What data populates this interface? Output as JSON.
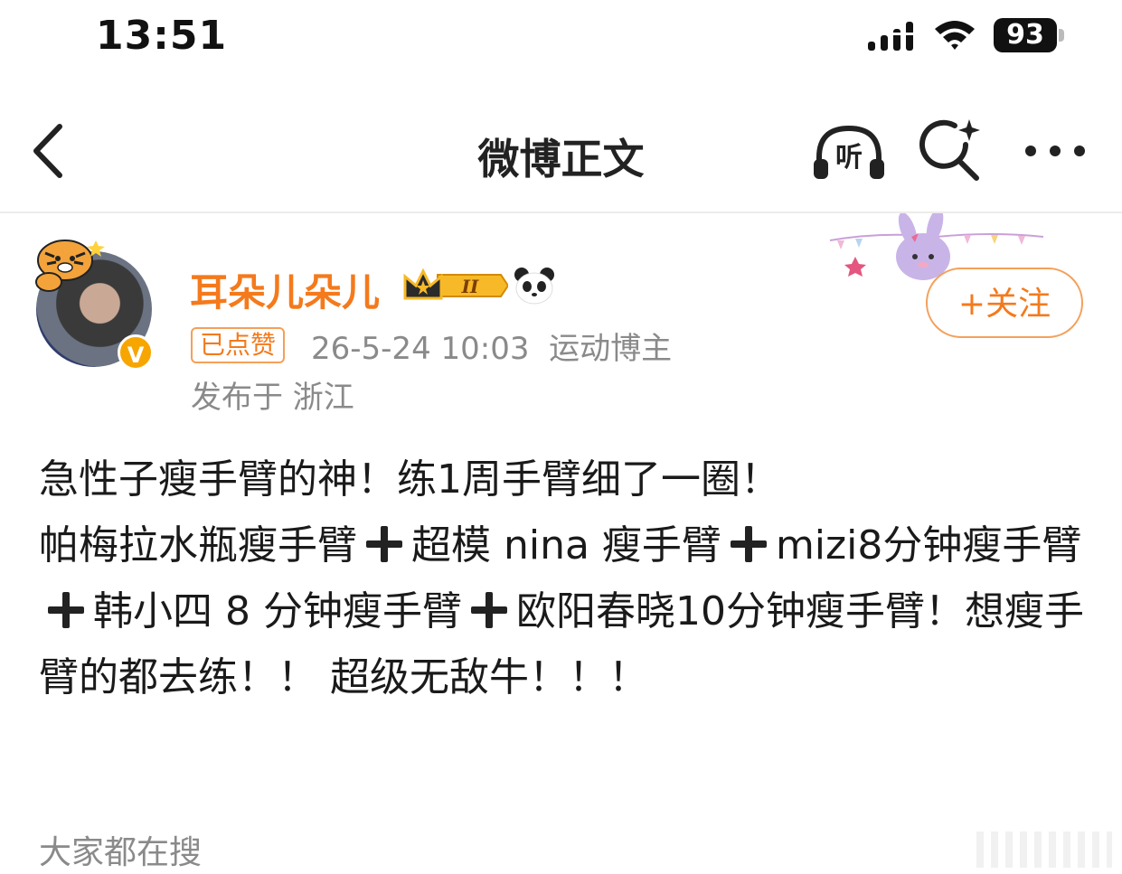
{
  "status_bar": {
    "time": "13:51",
    "battery": "93"
  },
  "nav": {
    "title": "微博正文"
  },
  "author": {
    "name": "耳朵儿朵儿",
    "verified_mark": "V",
    "crown_level": "II",
    "liked_tag": "已点赞",
    "meta": "26-5-24 10:03  运动博主",
    "location": "发布于 浙江",
    "follow_label": "+关注"
  },
  "post": {
    "seg1": "急性子瘦手臂的神！练1周手臂细了一圈！",
    "seg2": "帕梅拉水瓶瘦手臂",
    "seg3": "超模 nina 瘦手臂",
    "seg4": "mizi8分钟瘦手臂",
    "seg5": "韩小四 8 分钟瘦手臂",
    "seg6": "欧阳春晓10分钟瘦手臂！想瘦手臂的都去练！！ 超级无敌牛！！！"
  },
  "footer": {
    "search_hint": "大家都在搜"
  },
  "colors": {
    "accent": "#f47a1c",
    "muted": "#8a8a8a",
    "verified": "#f7a500"
  },
  "icons": [
    "back-arrow-icon",
    "listen-icon",
    "search-sparkle-icon",
    "more-icon",
    "signal-icon",
    "wifi-icon",
    "crown-badge-icon",
    "panda-icon",
    "tiger-sticker-icon"
  ]
}
